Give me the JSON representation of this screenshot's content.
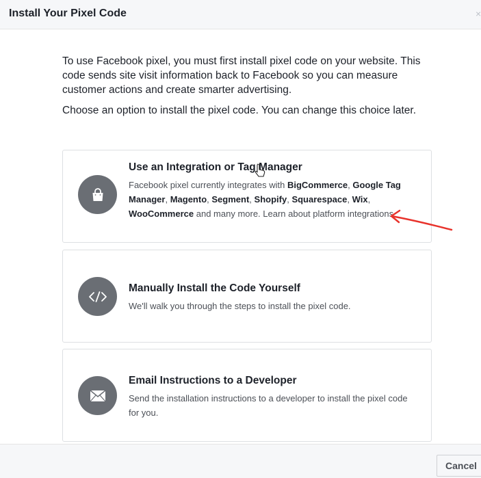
{
  "header": {
    "title": "Install Your Pixel Code",
    "close_glyph": "×"
  },
  "intro": "To use Facebook pixel, you must first install pixel code on your website. This code sends site visit information back to Facebook so you can measure customer actions and create smarter advertising.",
  "choose": "Choose an option to install the pixel code. You can change this choice later.",
  "options": [
    {
      "title": "Use an Integration or Tag Manager",
      "icon": "shopping-bag-icon",
      "desc_lead": "Facebook pixel currently integrates with ",
      "partners": [
        "BigCommerce",
        "Google Tag Manager",
        "Magento",
        "Segment",
        "Shopify",
        "Squarespace",
        "Wix",
        "WooCommerce"
      ],
      "separator": ", ",
      "desc_tail": " and many more. Learn about platform integrations."
    },
    {
      "title": "Manually Install the Code Yourself",
      "icon": "code-icon",
      "desc": "We'll walk you through the steps to install the pixel code."
    },
    {
      "title": "Email Instructions to a Developer",
      "icon": "envelope-icon",
      "desc": "Send the installation instructions to a developer to install the pixel code for you."
    }
  ],
  "footer": {
    "cancel_label": "Cancel"
  },
  "colors": {
    "icon_bg": "#6a6e74",
    "annotation": "#e8322b",
    "header_bg": "#f6f7f9"
  }
}
